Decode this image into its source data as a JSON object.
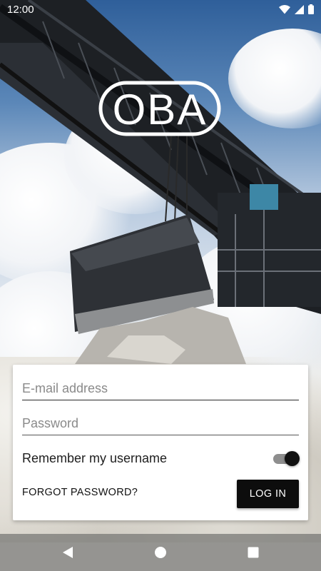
{
  "status_bar": {
    "time": "12:00",
    "icons": [
      "wifi-icon",
      "cellular-signal-icon",
      "battery-icon"
    ]
  },
  "logo": {
    "text": "OBA"
  },
  "login": {
    "email_placeholder": "E-mail address",
    "email_value": "",
    "password_placeholder": "Password",
    "password_value": "",
    "remember_label": "Remember my username",
    "remember_enabled": true,
    "forgot_label": "FORGOT PASSWORD?",
    "login_label": "LOG IN"
  },
  "nav_bar": {
    "buttons": [
      "back-icon",
      "home-icon",
      "recents-icon"
    ]
  },
  "colors": {
    "primary": "#0d0d0d",
    "card": "#ffffff",
    "placeholder": "#8a8a8a"
  }
}
